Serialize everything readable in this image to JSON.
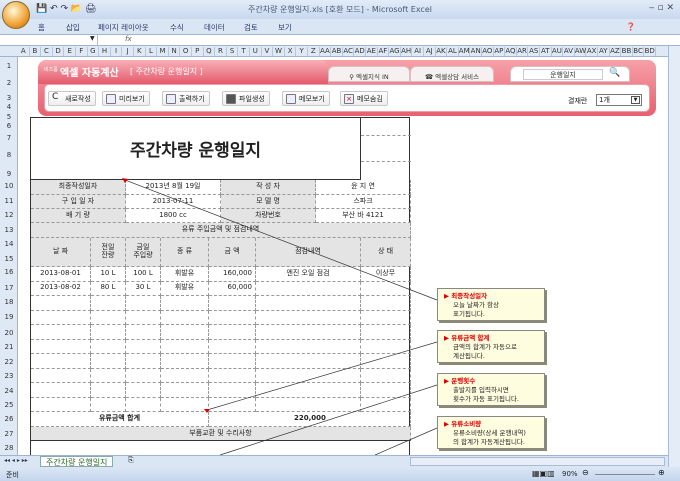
{
  "window": {
    "title": "주간차량 운행일지.xls  [호환 모드] - Microsoft Excel"
  },
  "ribbon_tabs": [
    "홈",
    "삽입",
    "페이지 레이아웃",
    "수식",
    "데이터",
    "검토",
    "보기"
  ],
  "formula_bar": {
    "fx": "fx",
    "value": ""
  },
  "columns": [
    "A",
    "B",
    "C",
    "D",
    "E",
    "F",
    "G",
    "H",
    "I",
    "J",
    "K",
    "L",
    "M",
    "N",
    "O",
    "P",
    "Q",
    "R",
    "S",
    "T",
    "U",
    "V",
    "W",
    "X",
    "Y",
    "Z",
    "AA",
    "AB",
    "AC",
    "AD",
    "AE",
    "AF",
    "AG",
    "AH",
    "AI",
    "AJ",
    "AK",
    "AL",
    "AM",
    "AN",
    "AO",
    "AP",
    "AQ",
    "AR",
    "AS",
    "AT",
    "AU",
    "AV",
    "AW",
    "AX",
    "AY",
    "AZ",
    "BB",
    "BC",
    "BD"
  ],
  "rows": [
    "1",
    "2",
    "3",
    "4",
    "5",
    "6",
    "7",
    "8",
    "9",
    "10",
    "11",
    "12",
    "13",
    "14",
    "15",
    "16",
    "17",
    "18",
    "19",
    "20",
    "21",
    "22",
    "23",
    "24",
    "25",
    "26",
    "27",
    "28"
  ],
  "banner": {
    "brand_small": "비즈폼",
    "brand": "엑셀 자동계산",
    "subtitle": "[ 주간차량 운행일지 ]",
    "tab1": "엑셀지식 IN",
    "tab2": "엑셀상담 서비스",
    "search_value": "운행일지",
    "buttons": [
      "새로작성",
      "미리보기",
      "출력하기",
      "파일생성",
      "메모보기",
      "메모숨김"
    ],
    "approval_label": "결재란",
    "approval_value": "1개"
  },
  "form": {
    "title": "주간차량 운행일지",
    "info": [
      [
        "최종작성일자",
        "2013년 8월 19일",
        "작 성 자",
        "윤 지 연"
      ],
      [
        "구 입 일 자",
        "2013-07-11",
        "모 델 명",
        "스파크"
      ],
      [
        "배 기 량",
        "1800 cc",
        "차량번호",
        "부산 바 4121"
      ]
    ],
    "section1": "유류 주입금액 및 점검내역",
    "headers": [
      "날 짜",
      "전일\n잔량",
      "금일\n주입량",
      "종 류",
      "금 액",
      "점검내역",
      "상 태"
    ],
    "entries": [
      [
        "2013-08-01",
        "10 L",
        "100 L",
        "휘발유",
        "160,000",
        "엔진 오일 점검",
        "이상무"
      ],
      [
        "2013-08-02",
        "80 L",
        "30 L",
        "휘발유",
        "60,000",
        "",
        ""
      ]
    ],
    "total_label": "유류금액 합계",
    "total_value": "220,000",
    "section2": "부품교환 및 수리사항"
  },
  "callouts": [
    {
      "title": "최종작성일자",
      "body": "오늘 날짜가 항상\n표기됩니다."
    },
    {
      "title": "유류금액 합계",
      "body": "금액의 합계가 자동으로\n계산됩니다."
    },
    {
      "title": "운행횟수",
      "body": "출발지를 입력하시면\n횟수가 자동 표기됩니다."
    },
    {
      "title": "유류소비량",
      "body": "유류소비량(상세 운행내역)\n의 합계가 자동계산됩니다."
    }
  ],
  "sheet_tab": "주간차량 운행일지",
  "status": {
    "ready": "준비",
    "zoom": "90%"
  }
}
